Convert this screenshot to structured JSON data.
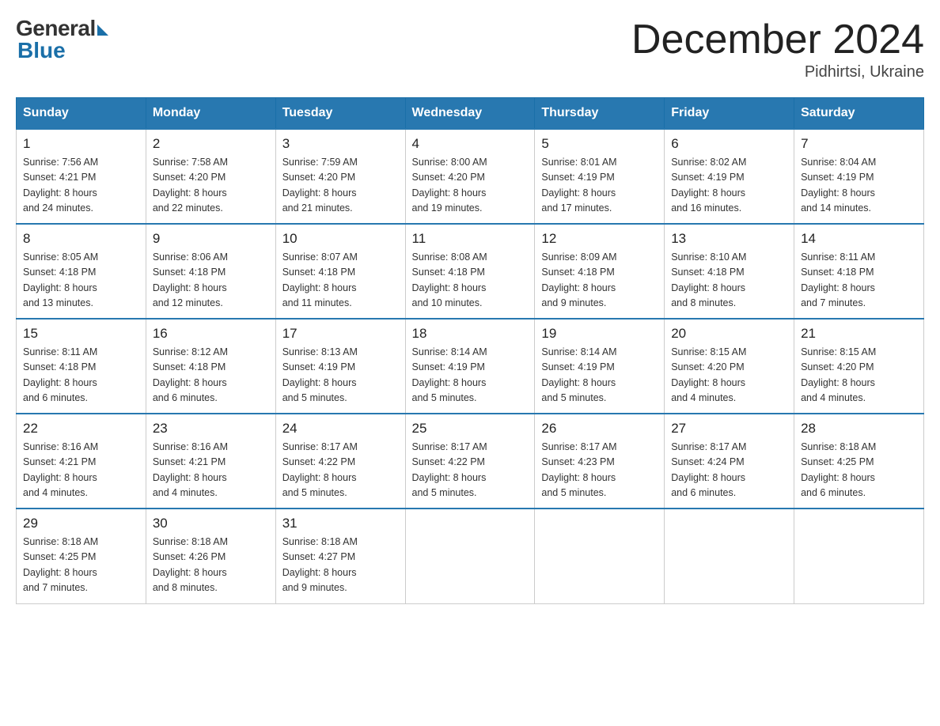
{
  "logo": {
    "general": "General",
    "blue": "Blue"
  },
  "title": "December 2024",
  "subtitle": "Pidhirtsi, Ukraine",
  "days_of_week": [
    "Sunday",
    "Monday",
    "Tuesday",
    "Wednesday",
    "Thursday",
    "Friday",
    "Saturday"
  ],
  "weeks": [
    [
      {
        "day": "1",
        "sunrise": "7:56 AM",
        "sunset": "4:21 PM",
        "daylight": "8 hours and 24 minutes."
      },
      {
        "day": "2",
        "sunrise": "7:58 AM",
        "sunset": "4:20 PM",
        "daylight": "8 hours and 22 minutes."
      },
      {
        "day": "3",
        "sunrise": "7:59 AM",
        "sunset": "4:20 PM",
        "daylight": "8 hours and 21 minutes."
      },
      {
        "day": "4",
        "sunrise": "8:00 AM",
        "sunset": "4:20 PM",
        "daylight": "8 hours and 19 minutes."
      },
      {
        "day": "5",
        "sunrise": "8:01 AM",
        "sunset": "4:19 PM",
        "daylight": "8 hours and 17 minutes."
      },
      {
        "day": "6",
        "sunrise": "8:02 AM",
        "sunset": "4:19 PM",
        "daylight": "8 hours and 16 minutes."
      },
      {
        "day": "7",
        "sunrise": "8:04 AM",
        "sunset": "4:19 PM",
        "daylight": "8 hours and 14 minutes."
      }
    ],
    [
      {
        "day": "8",
        "sunrise": "8:05 AM",
        "sunset": "4:18 PM",
        "daylight": "8 hours and 13 minutes."
      },
      {
        "day": "9",
        "sunrise": "8:06 AM",
        "sunset": "4:18 PM",
        "daylight": "8 hours and 12 minutes."
      },
      {
        "day": "10",
        "sunrise": "8:07 AM",
        "sunset": "4:18 PM",
        "daylight": "8 hours and 11 minutes."
      },
      {
        "day": "11",
        "sunrise": "8:08 AM",
        "sunset": "4:18 PM",
        "daylight": "8 hours and 10 minutes."
      },
      {
        "day": "12",
        "sunrise": "8:09 AM",
        "sunset": "4:18 PM",
        "daylight": "8 hours and 9 minutes."
      },
      {
        "day": "13",
        "sunrise": "8:10 AM",
        "sunset": "4:18 PM",
        "daylight": "8 hours and 8 minutes."
      },
      {
        "day": "14",
        "sunrise": "8:11 AM",
        "sunset": "4:18 PM",
        "daylight": "8 hours and 7 minutes."
      }
    ],
    [
      {
        "day": "15",
        "sunrise": "8:11 AM",
        "sunset": "4:18 PM",
        "daylight": "8 hours and 6 minutes."
      },
      {
        "day": "16",
        "sunrise": "8:12 AM",
        "sunset": "4:18 PM",
        "daylight": "8 hours and 6 minutes."
      },
      {
        "day": "17",
        "sunrise": "8:13 AM",
        "sunset": "4:19 PM",
        "daylight": "8 hours and 5 minutes."
      },
      {
        "day": "18",
        "sunrise": "8:14 AM",
        "sunset": "4:19 PM",
        "daylight": "8 hours and 5 minutes."
      },
      {
        "day": "19",
        "sunrise": "8:14 AM",
        "sunset": "4:19 PM",
        "daylight": "8 hours and 5 minutes."
      },
      {
        "day": "20",
        "sunrise": "8:15 AM",
        "sunset": "4:20 PM",
        "daylight": "8 hours and 4 minutes."
      },
      {
        "day": "21",
        "sunrise": "8:15 AM",
        "sunset": "4:20 PM",
        "daylight": "8 hours and 4 minutes."
      }
    ],
    [
      {
        "day": "22",
        "sunrise": "8:16 AM",
        "sunset": "4:21 PM",
        "daylight": "8 hours and 4 minutes."
      },
      {
        "day": "23",
        "sunrise": "8:16 AM",
        "sunset": "4:21 PM",
        "daylight": "8 hours and 4 minutes."
      },
      {
        "day": "24",
        "sunrise": "8:17 AM",
        "sunset": "4:22 PM",
        "daylight": "8 hours and 5 minutes."
      },
      {
        "day": "25",
        "sunrise": "8:17 AM",
        "sunset": "4:22 PM",
        "daylight": "8 hours and 5 minutes."
      },
      {
        "day": "26",
        "sunrise": "8:17 AM",
        "sunset": "4:23 PM",
        "daylight": "8 hours and 5 minutes."
      },
      {
        "day": "27",
        "sunrise": "8:17 AM",
        "sunset": "4:24 PM",
        "daylight": "8 hours and 6 minutes."
      },
      {
        "day": "28",
        "sunrise": "8:18 AM",
        "sunset": "4:25 PM",
        "daylight": "8 hours and 6 minutes."
      }
    ],
    [
      {
        "day": "29",
        "sunrise": "8:18 AM",
        "sunset": "4:25 PM",
        "daylight": "8 hours and 7 minutes."
      },
      {
        "day": "30",
        "sunrise": "8:18 AM",
        "sunset": "4:26 PM",
        "daylight": "8 hours and 8 minutes."
      },
      {
        "day": "31",
        "sunrise": "8:18 AM",
        "sunset": "4:27 PM",
        "daylight": "8 hours and 9 minutes."
      },
      null,
      null,
      null,
      null
    ]
  ],
  "labels": {
    "sunrise": "Sunrise:",
    "sunset": "Sunset:",
    "daylight": "Daylight:"
  }
}
